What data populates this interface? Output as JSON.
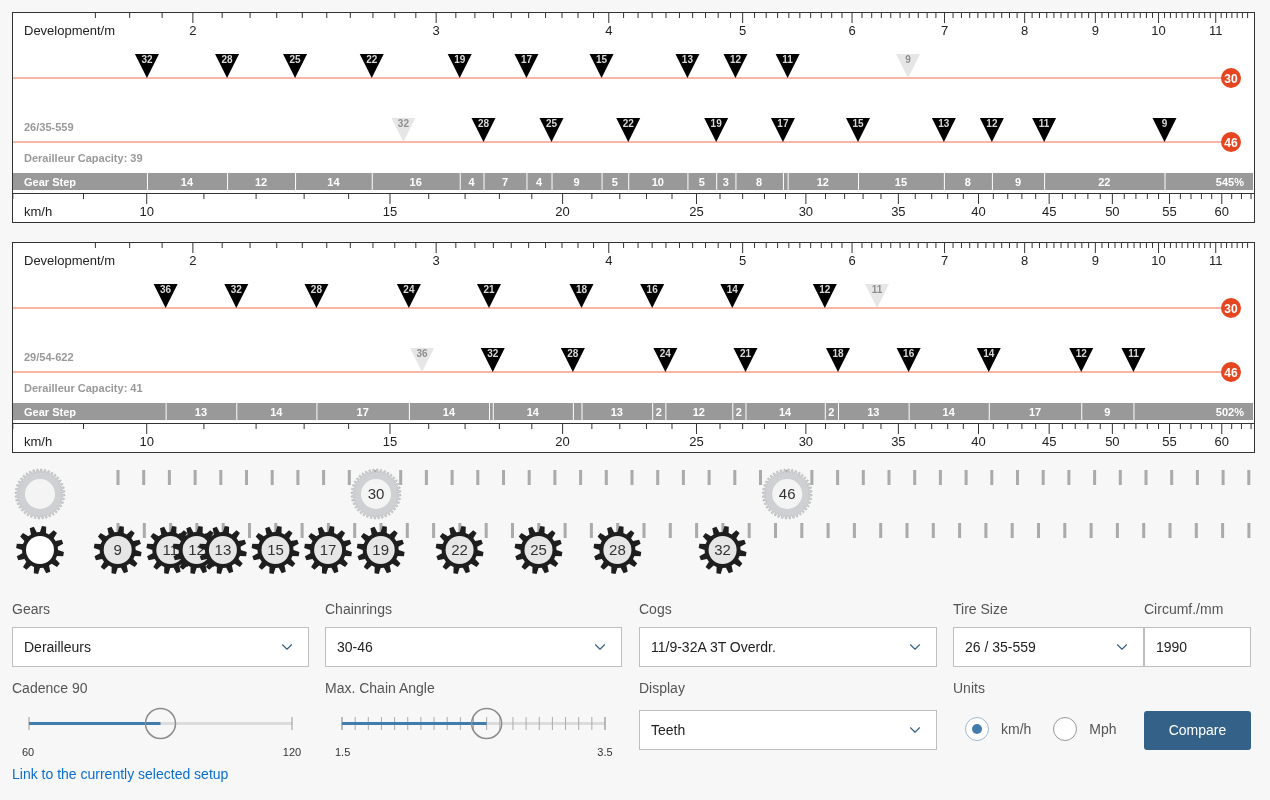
{
  "charts": [
    {
      "axis_title": "Development/m",
      "dev_ticks": [
        "2",
        "3",
        "4",
        "5",
        "6",
        "7",
        "8",
        "9",
        "10",
        "11"
      ],
      "tire": "26/35-559",
      "capacity": "Derailleur Capacity: 39",
      "step_title": "Gear Step",
      "steps": [
        "14",
        "12",
        "14",
        "16",
        "4",
        "7",
        "4",
        "9",
        "5",
        "10",
        "5",
        "3",
        "8",
        "12",
        "15",
        "8",
        "9",
        "22"
      ],
      "range": "545%",
      "speed_title": "km/h",
      "speed_ticks": [
        "10",
        "15",
        "20",
        "25",
        "30",
        "35",
        "40",
        "45",
        "50",
        "55",
        "60"
      ],
      "rings": [
        {
          "teeth": "30",
          "cogs": [
            {
              "label": "32",
              "faded": false
            },
            {
              "label": "28",
              "faded": false
            },
            {
              "label": "25",
              "faded": false
            },
            {
              "label": "22",
              "faded": false
            },
            {
              "label": "19",
              "faded": false
            },
            {
              "label": "17",
              "faded": false
            },
            {
              "label": "15",
              "faded": false
            },
            {
              "label": "13",
              "faded": false
            },
            {
              "label": "12",
              "faded": false
            },
            {
              "label": "11",
              "faded": false
            },
            {
              "label": "9",
              "faded": true
            }
          ]
        },
        {
          "teeth": "46",
          "cogs": [
            {
              "label": "32",
              "faded": true
            },
            {
              "label": "28",
              "faded": false
            },
            {
              "label": "25",
              "faded": false
            },
            {
              "label": "22",
              "faded": false
            },
            {
              "label": "19",
              "faded": false
            },
            {
              "label": "17",
              "faded": false
            },
            {
              "label": "15",
              "faded": false
            },
            {
              "label": "13",
              "faded": false
            },
            {
              "label": "12",
              "faded": false
            },
            {
              "label": "11",
              "faded": false
            },
            {
              "label": "9",
              "faded": false
            }
          ]
        }
      ]
    },
    {
      "axis_title": "Development/m",
      "dev_ticks": [
        "2",
        "3",
        "4",
        "5",
        "6",
        "7",
        "8",
        "9",
        "10",
        "11"
      ],
      "tire": "29/54-622",
      "capacity": "Derailleur Capacity: 41",
      "step_title": "Gear Step",
      "steps": [
        "13",
        "14",
        "17",
        "14",
        "14",
        "13",
        "2",
        "12",
        "2",
        "14",
        "2",
        "13",
        "14",
        "17",
        "9"
      ],
      "range": "502%",
      "speed_title": "km/h",
      "speed_ticks": [
        "10",
        "15",
        "20",
        "25",
        "30",
        "35",
        "40",
        "45",
        "50",
        "55",
        "60"
      ],
      "rings": [
        {
          "teeth": "30",
          "cogs": [
            {
              "label": "36",
              "faded": false
            },
            {
              "label": "32",
              "faded": false
            },
            {
              "label": "28",
              "faded": false
            },
            {
              "label": "24",
              "faded": false
            },
            {
              "label": "21",
              "faded": false
            },
            {
              "label": "18",
              "faded": false
            },
            {
              "label": "16",
              "faded": false
            },
            {
              "label": "14",
              "faded": false
            },
            {
              "label": "12",
              "faded": false
            },
            {
              "label": "11",
              "faded": true
            }
          ]
        },
        {
          "teeth": "46",
          "cogs": [
            {
              "label": "36",
              "faded": true
            },
            {
              "label": "32",
              "faded": false
            },
            {
              "label": "28",
              "faded": false
            },
            {
              "label": "24",
              "faded": false
            },
            {
              "label": "21",
              "faded": false
            },
            {
              "label": "18",
              "faded": false
            },
            {
              "label": "16",
              "faded": false
            },
            {
              "label": "14",
              "faded": false
            },
            {
              "label": "12",
              "faded": false
            },
            {
              "label": "11",
              "faded": false
            }
          ]
        }
      ]
    }
  ],
  "gears": {
    "chainrings": [
      "30",
      "46"
    ],
    "cogs": [
      "9",
      "11",
      "12",
      "13",
      "15",
      "17",
      "19",
      "22",
      "25",
      "28",
      "32"
    ]
  },
  "form": {
    "gears": {
      "label": "Gears",
      "value": "Derailleurs"
    },
    "chainrings": {
      "label": "Chainrings",
      "value": "30-46"
    },
    "cogs": {
      "label": "Cogs",
      "value": "11/9-32A 3T Overdr."
    },
    "tire": {
      "label": "Tire Size",
      "value": "26 / 35-559"
    },
    "circumference": {
      "label": "Circumf./mm",
      "value": "1990"
    },
    "cadence": {
      "label": "Cadence 90",
      "level": 0.5,
      "min": "60",
      "max": "120"
    },
    "chain_angle": {
      "label": "Max. Chain Angle",
      "level": 0.55,
      "min": "1.5",
      "max": "3.5"
    },
    "display": {
      "label": "Display",
      "value": "Teeth"
    },
    "units": {
      "label": "Units",
      "options": [
        {
          "label": "km/h",
          "selected": true
        },
        {
          "label": "Mph",
          "selected": false
        }
      ]
    },
    "compare_button": "Compare",
    "link": "Link to the currently selected setup"
  }
}
